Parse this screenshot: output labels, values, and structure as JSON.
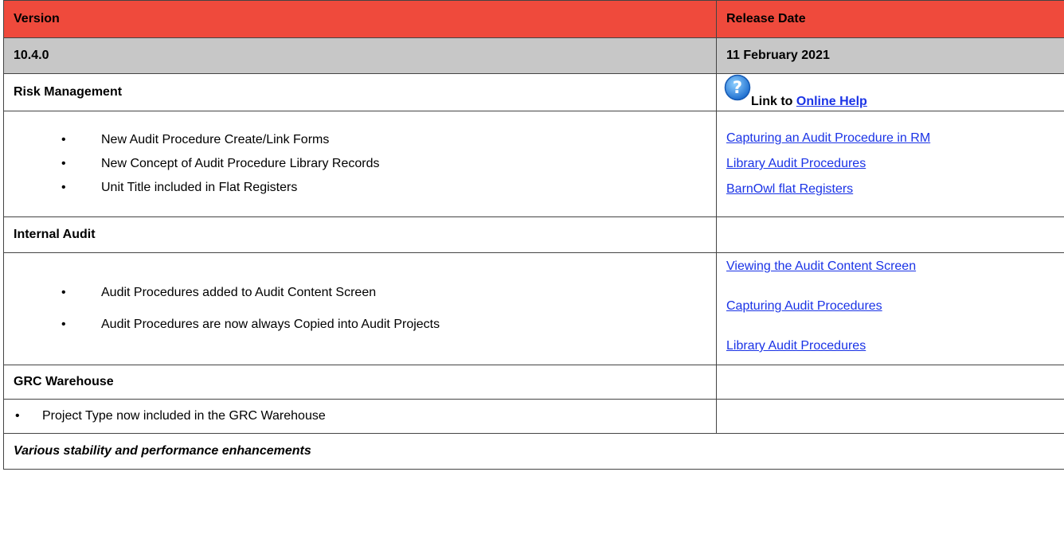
{
  "header": {
    "version_label": "Version",
    "release_date_label": "Release Date"
  },
  "version": {
    "number": "10.4.0",
    "release_date": "11 February 2021"
  },
  "help": {
    "icon": "help-icon",
    "prefix": "Link to ",
    "link": "Online Help"
  },
  "sections": {
    "risk": {
      "title": "Risk Management",
      "items": [
        "New Audit Procedure Create/Link Forms",
        "New Concept of Audit Procedure Library Records",
        "Unit Title included in Flat Registers"
      ],
      "links": [
        "Capturing an Audit Procedure in RM",
        "Library Audit Procedures",
        "BarnOwl flat Registers"
      ]
    },
    "internal_audit": {
      "title": "Internal Audit",
      "items": [
        "Audit Procedures added to Audit Content Screen",
        "Audit Procedures are now always Copied into Audit Projects"
      ],
      "links": [
        "Viewing the Audit Content Screen",
        "Capturing Audit Procedures",
        "Library Audit Procedures"
      ]
    },
    "grc": {
      "title": "GRC Warehouse",
      "items": [
        "Project Type now included in the GRC Warehouse"
      ]
    }
  },
  "footer_note": "Various stability and performance enhancements",
  "colors": {
    "header_bg": "#ef4a3c",
    "version_bg": "#c7c7c7",
    "link": "#1a33e6"
  }
}
